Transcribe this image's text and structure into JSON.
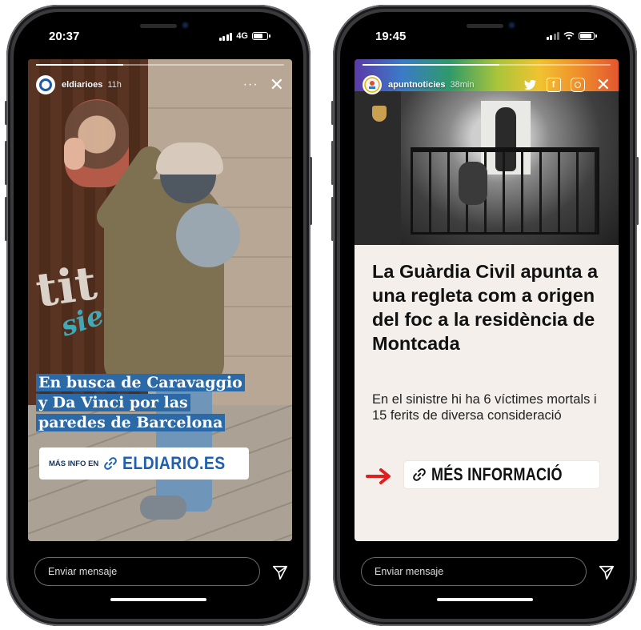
{
  "left_phone": {
    "status": {
      "time": "20:37",
      "network": "4G"
    },
    "story": {
      "username": "eldiarioes",
      "time_ago": "11h",
      "more_label": "···",
      "close_label": "✕",
      "headline": "En busca de Caravaggio y Da Vinci por las paredes de Barcelona",
      "cta_small": "MÁS INFO EN",
      "cta_big": "ELDIARIO.ES",
      "progress": 0.35
    },
    "message_placeholder": "Enviar mensaje"
  },
  "right_phone": {
    "status": {
      "time": "19:45"
    },
    "story": {
      "username": "apuntnoticies",
      "time_ago": "38min",
      "close_label": "✕",
      "headline": "La Guàrdia Civil apunta a una regleta com a origen del foc a la residència de Montcada",
      "subtitle": "En el sinistre hi ha 6 víctimes mortals i 15 ferits de diversa consideració",
      "cta": "MÉS INFORMACIÓ",
      "progress": 0.55
    },
    "message_placeholder": "Enviar mensaje"
  },
  "colors": {
    "eldiario_blue": "#2b6aa7",
    "link_blue": "#1f5fb0",
    "arrow_red": "#e01e1e",
    "card_bg": "#f4efea"
  },
  "icons": [
    "link-icon",
    "send-icon",
    "close-icon",
    "twitter-icon",
    "facebook-icon",
    "instagram-icon",
    "arrow-icon",
    "battery-icon",
    "signal-icon",
    "wifi-icon"
  ]
}
